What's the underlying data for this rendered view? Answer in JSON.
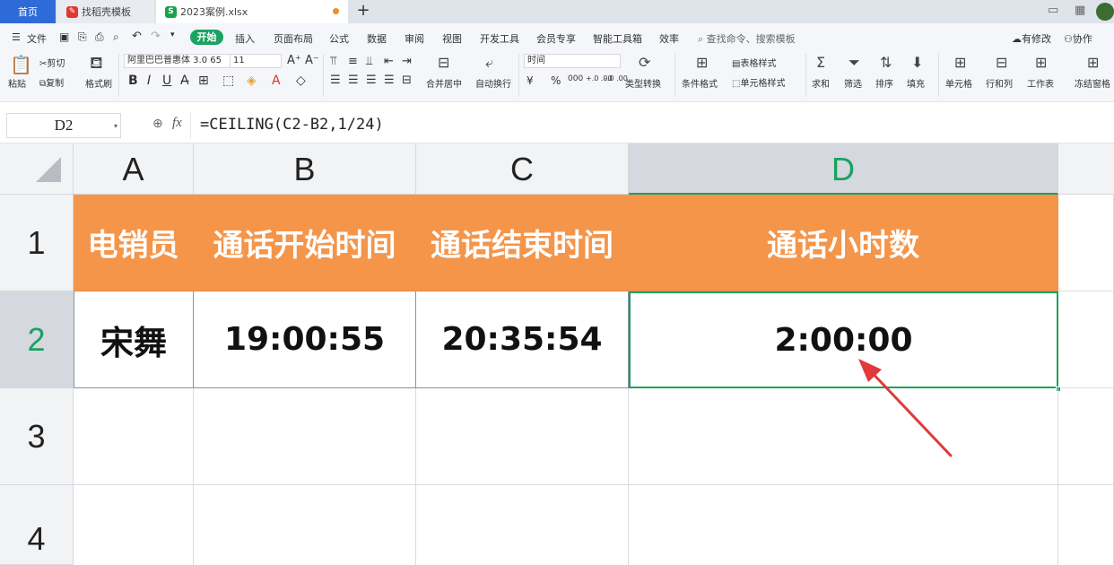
{
  "tabs": {
    "home": "首页",
    "template": "找稻壳模板",
    "document": "2023案例.xlsx",
    "new_tab": "+"
  },
  "menu": {
    "file": "文件",
    "items": [
      "开始",
      "插入",
      "页面布局",
      "公式",
      "数据",
      "审阅",
      "视图",
      "开发工具",
      "会员专享",
      "智能工具箱",
      "效率"
    ],
    "search_placeholder": "查找命令、搜索模板",
    "has_changes": "有修改",
    "collab": "协作"
  },
  "ribbon": {
    "paste": "粘贴",
    "cut": "剪切",
    "copy": "复制",
    "format_painter": "格式刷",
    "font_name": "阿里巴巴普惠体 3.0 65",
    "font_size": "11",
    "merge_center": "合并居中",
    "wrap_text": "自动换行",
    "number_format": "时间",
    "type_convert": "类型转换",
    "conditional_format": "条件格式",
    "table_style": "表格样式",
    "cell_style": "单元格样式",
    "sum": "求和",
    "filter": "筛选",
    "sort": "排序",
    "fill": "填充",
    "cells": "单元格",
    "rows_cols": "行和列",
    "worksheet": "工作表",
    "freeze": "冻结窗格",
    "currency": "¥",
    "percent": "%",
    "thousands": "000",
    "inc_decimal": "+.0 .00",
    "dec_decimal": "-.0 .00"
  },
  "formula_bar": {
    "cell_ref": "D2",
    "fx": "fx",
    "formula": "=CEILING(C2-B2,1/24)"
  },
  "sheet": {
    "columns": [
      "A",
      "B",
      "C",
      "D"
    ],
    "rows": [
      "1",
      "2",
      "3",
      "4"
    ],
    "header_row": [
      "电销员",
      "通话开始时间",
      "通话结束时间",
      "通话小时数"
    ],
    "data_row": [
      "宋舞",
      "19:00:55",
      "20:35:54",
      "2:00:00"
    ],
    "active_cell": "D2",
    "colors": {
      "header_fill": "#f5954a",
      "header_text": "#ffffff",
      "selection": "#1aa260",
      "annotation_arrow": "#e03a3a"
    }
  }
}
